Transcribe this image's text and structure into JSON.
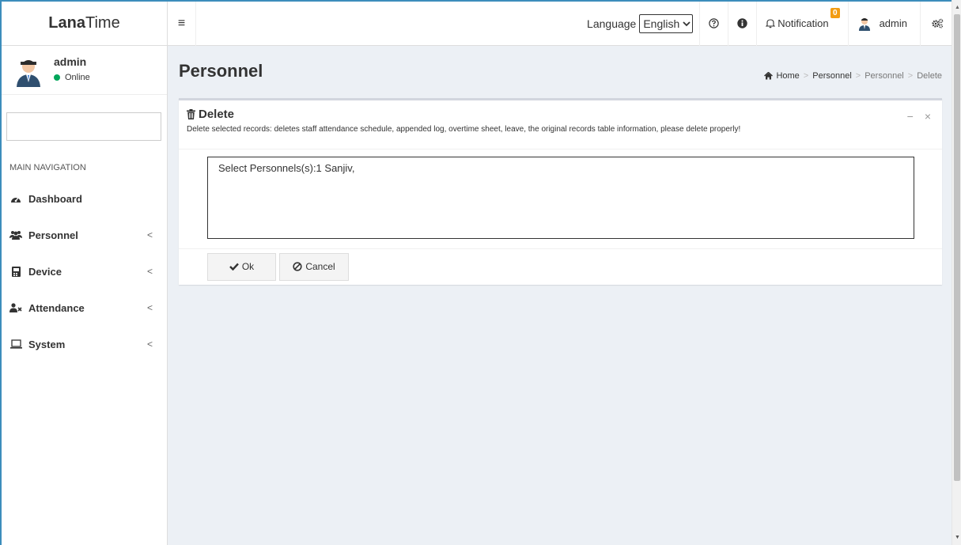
{
  "brand": {
    "bold": "Lana",
    "light": "Time"
  },
  "user_panel": {
    "name": "admin",
    "status": "Online"
  },
  "sidebar": {
    "search_value": "",
    "header": "MAIN NAVIGATION",
    "items": [
      {
        "label": "Dashboard",
        "icon": "dashboard-icon",
        "has_children": false
      },
      {
        "label": "Personnel",
        "icon": "users-icon",
        "has_children": true
      },
      {
        "label": "Device",
        "icon": "device-icon",
        "has_children": true
      },
      {
        "label": "Attendance",
        "icon": "user-x-icon",
        "has_children": true
      },
      {
        "label": "System",
        "icon": "laptop-icon",
        "has_children": true
      }
    ],
    "chevron": "<"
  },
  "topbar": {
    "language_label": "Language",
    "language_value": "English",
    "notification_label": "Notification",
    "notification_count": "0",
    "user_name": "admin"
  },
  "page": {
    "title": "Personnel",
    "breadcrumb": [
      "Home",
      "Personnel",
      "Personnel",
      "Delete"
    ],
    "breadcrumb_sep": ">"
  },
  "box": {
    "title": "Delete",
    "description": "Delete selected records: deletes staff attendance schedule, appended log, overtime sheet, leave, the original records table information, please delete properly!",
    "minimize": "−",
    "close": "×",
    "selected_text": "Select Personnels(s):1 Sanjiv,",
    "ok_label": "Ok",
    "cancel_label": "Cancel"
  },
  "colors": {
    "accent": "#3c8dbc",
    "online": "#00a65a",
    "badge": "#f39c12"
  }
}
